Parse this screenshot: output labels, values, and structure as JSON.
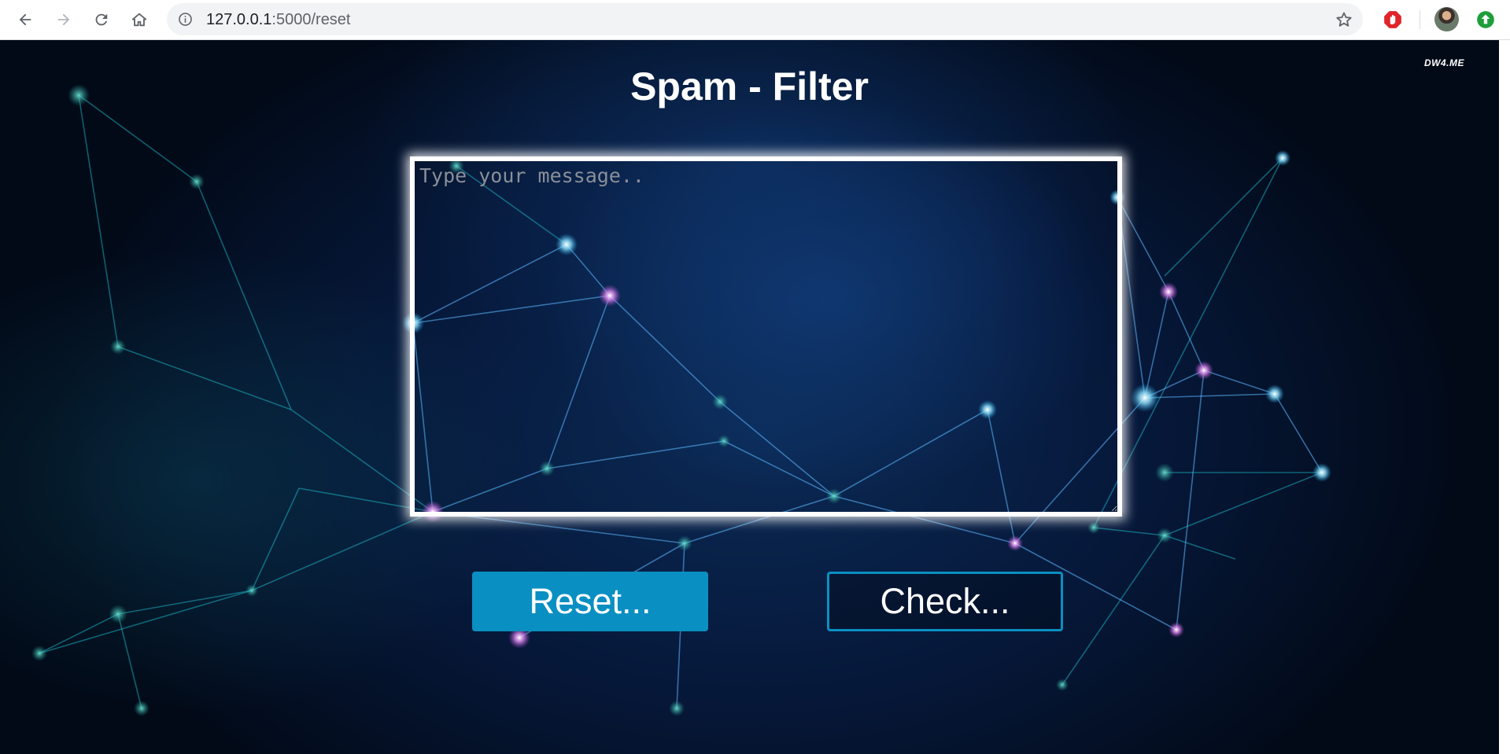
{
  "browser": {
    "url_host": "127.0.0.1",
    "url_path": ":5000/reset",
    "icons": {
      "back": "back-arrow-icon",
      "forward": "forward-arrow-icon",
      "reload": "reload-icon",
      "home": "home-icon",
      "info": "info-icon",
      "bookmark": "star-icon",
      "adblock": "adblock-icon",
      "update": "update-arrow-icon"
    }
  },
  "page": {
    "watermark": "DW4.ME",
    "title": "Spam - Filter",
    "message_placeholder": "Type your message..",
    "message_value": "",
    "reset_label": "Reset...",
    "check_label": "Check..."
  },
  "colors": {
    "button_accent": "#0a8fc2",
    "background_dark": "#06183a",
    "title_text": "#ffffff"
  }
}
